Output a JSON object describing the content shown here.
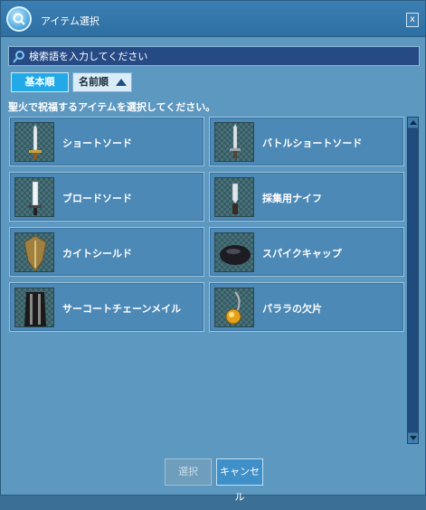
{
  "window": {
    "title": "アイテム選択",
    "close_label": "x"
  },
  "search": {
    "placeholder": "検索語を入力してください"
  },
  "sort": {
    "basic_label": "基本順",
    "name_label": "名前順"
  },
  "instruction": "聖火で祝福するアイテムを選択してください。",
  "items": [
    {
      "label": "ショートソード",
      "icon": "short-sword-icon"
    },
    {
      "label": "バトルショートソード",
      "icon": "battle-short-sword-icon"
    },
    {
      "label": "ブロードソード",
      "icon": "broad-sword-icon"
    },
    {
      "label": "採集用ナイフ",
      "icon": "gathering-knife-icon"
    },
    {
      "label": "カイトシールド",
      "icon": "kite-shield-icon"
    },
    {
      "label": "スパイクキャップ",
      "icon": "spike-cap-icon"
    },
    {
      "label": "サーコートチェーンメイル",
      "icon": "surcoat-chainmail-icon"
    },
    {
      "label": "パララの欠片",
      "icon": "palala-fragment-icon"
    }
  ],
  "footer": {
    "select_label": "選択",
    "cancel_label": "キャンセル"
  }
}
